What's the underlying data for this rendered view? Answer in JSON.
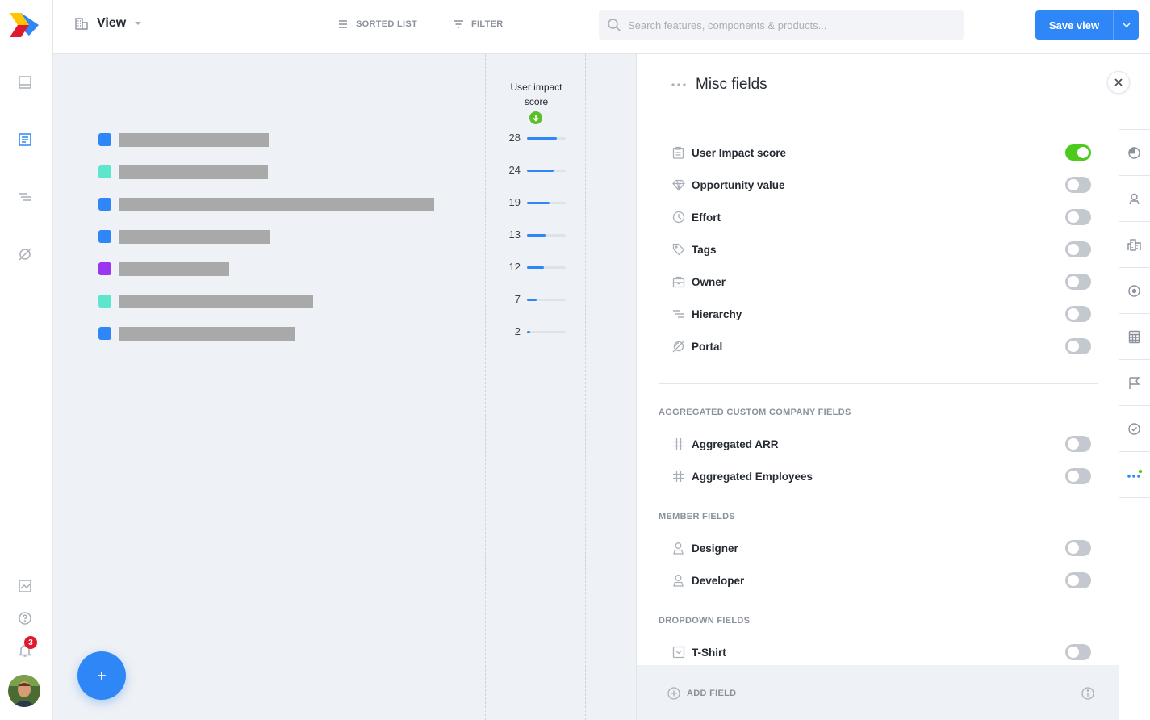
{
  "header": {
    "view_label": "View",
    "sorted_list_label": "SORTED LIST",
    "filter_label": "FILTER",
    "search_placeholder": "Search features, components & products...",
    "save_label": "Save view"
  },
  "sidebar": {
    "notification_count": "3"
  },
  "colors": {
    "accent": "#2f86f6",
    "toggle_on": "#4ccb1c",
    "row_blue": "#2f86f6",
    "row_teal": "#5ee6cc",
    "row_purple": "#9a36f0"
  },
  "list": {
    "score_header": "User impact score",
    "rows": [
      {
        "color": "#2f86f6",
        "score": "28",
        "fill": 0.78
      },
      {
        "color": "#5ee6cc",
        "score": "24",
        "fill": 0.68
      },
      {
        "color": "#2f86f6",
        "score": "19",
        "fill": 0.58
      },
      {
        "color": "#2f86f6",
        "score": "13",
        "fill": 0.47
      },
      {
        "color": "#9a36f0",
        "score": "12",
        "fill": 0.43
      },
      {
        "color": "#5ee6cc",
        "score": "7",
        "fill": 0.26
      },
      {
        "color": "#2f86f6",
        "score": "2",
        "fill": 0.09
      }
    ]
  },
  "panel": {
    "title": "Misc fields",
    "misc_fields": [
      {
        "label": "User Impact score",
        "icon": "clipboard-icon",
        "enabled": true
      },
      {
        "label": "Opportunity value",
        "icon": "diamond-icon",
        "enabled": false
      },
      {
        "label": "Effort",
        "icon": "clock-icon",
        "enabled": false
      },
      {
        "label": "Tags",
        "icon": "tag-icon",
        "enabled": false
      },
      {
        "label": "Owner",
        "icon": "briefcase-icon",
        "enabled": false
      },
      {
        "label": "Hierarchy",
        "icon": "hierarchy-icon",
        "enabled": false
      },
      {
        "label": "Portal",
        "icon": "portal-icon",
        "enabled": false
      }
    ],
    "company_group_title": "AGGREGATED CUSTOM COMPANY FIELDS",
    "company_fields": [
      {
        "label": "Aggregated ARR",
        "icon": "hash-icon",
        "enabled": false
      },
      {
        "label": "Aggregated Employees",
        "icon": "hash-icon",
        "enabled": false
      }
    ],
    "member_group_title": "MEMBER FIELDS",
    "member_fields": [
      {
        "label": "Designer",
        "icon": "person-icon",
        "enabled": false
      },
      {
        "label": "Developer",
        "icon": "person-icon",
        "enabled": false
      }
    ],
    "dropdown_group_title": "DROPDOWN FIELDS",
    "dropdown_fields": [
      {
        "label": "T-Shirt",
        "icon": "dropdown-icon",
        "enabled": false
      }
    ],
    "add_field_label": "ADD FIELD"
  }
}
